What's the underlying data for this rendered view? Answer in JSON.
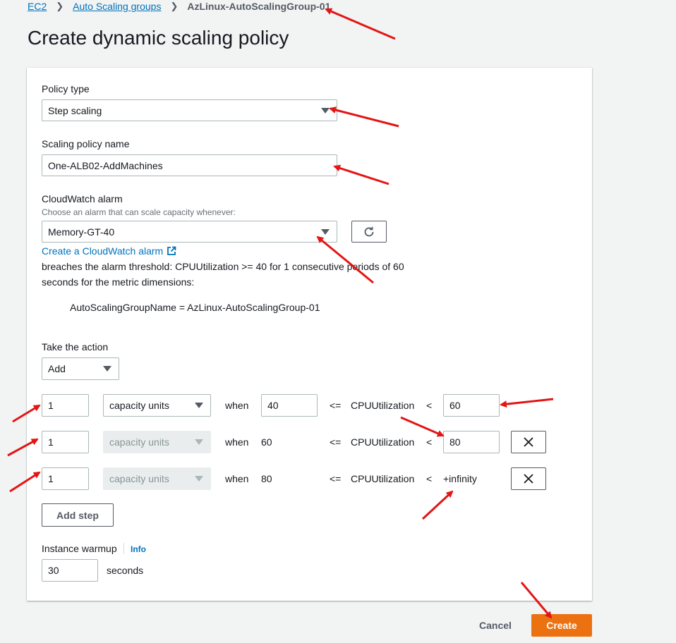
{
  "breadcrumb": {
    "items": [
      "EC2",
      "Auto Scaling groups"
    ],
    "current": "AzLinux-AutoScalingGroup-01"
  },
  "page_title": "Create dynamic scaling policy",
  "policy_type": {
    "label": "Policy type",
    "value": "Step scaling"
  },
  "policy_name": {
    "label": "Scaling policy name",
    "value": "One-ALB02-AddMachines"
  },
  "alarm": {
    "label": "CloudWatch alarm",
    "description": "Choose an alarm that can scale capacity whenever:",
    "value": "Memory-GT-40",
    "create_link": "Create a CloudWatch alarm",
    "breach_text_1": "breaches the alarm threshold: CPUUtilization >= 40 for 1 consecutive periods of 60",
    "breach_text_2": "seconds for the metric dimensions:",
    "dimension": "AutoScalingGroupName = AzLinux-AutoScalingGroup-01"
  },
  "action": {
    "label": "Take the action",
    "value": "Add"
  },
  "steps": [
    {
      "amount": "1",
      "unit": "capacity units",
      "when": "when",
      "lower": "40",
      "op": "<=",
      "metric": "CPUUtilization",
      "lt": "<",
      "upper": "60"
    },
    {
      "amount": "1",
      "unit": "capacity units",
      "when": "when",
      "lower": "60",
      "op": "<=",
      "metric": "CPUUtilization",
      "lt": "<",
      "upper": "80"
    },
    {
      "amount": "1",
      "unit": "capacity units",
      "when": "when",
      "lower": "80",
      "op": "<=",
      "metric": "CPUUtilization",
      "lt": "<",
      "upper": "+infinity"
    }
  ],
  "add_step_label": "Add step",
  "warmup": {
    "label": "Instance warmup",
    "info": "Info",
    "value": "30",
    "unit": "seconds"
  },
  "footer": {
    "cancel_label": "Cancel",
    "create_label": "Create"
  },
  "colors": {
    "accent": "#ec7211",
    "link": "#0073bb",
    "annotation": "#e31515"
  }
}
